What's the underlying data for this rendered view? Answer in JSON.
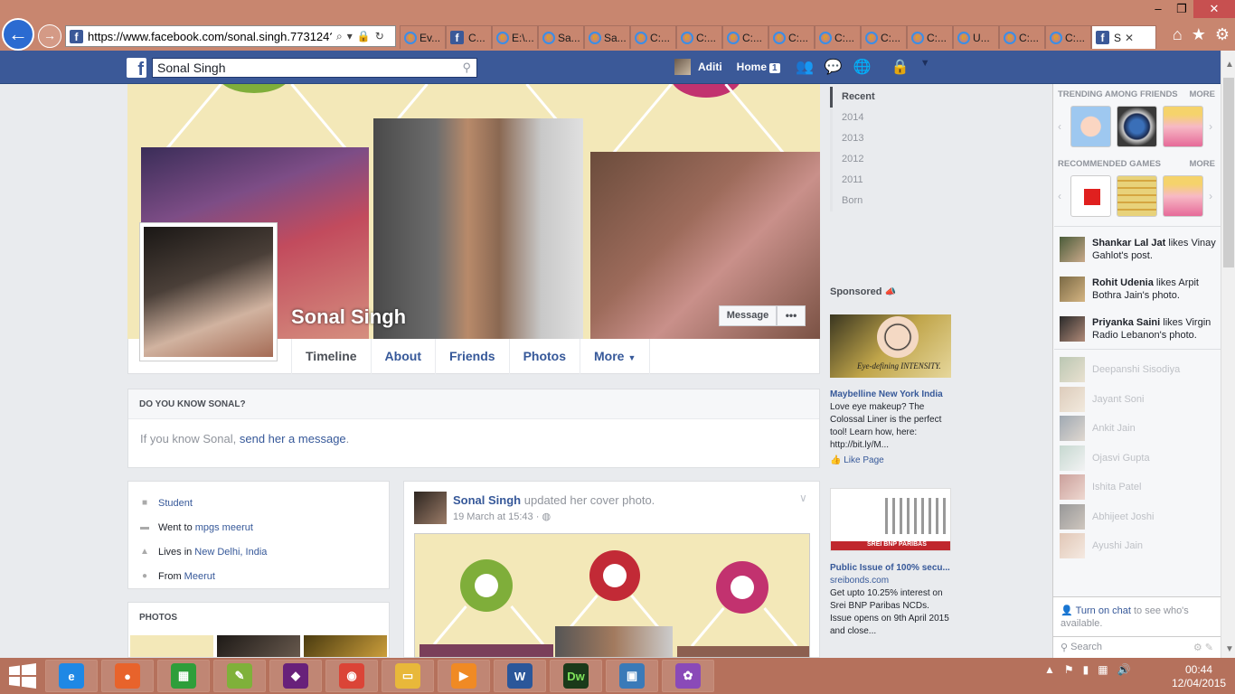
{
  "browser": {
    "url": "https://www.facebook.com/sonal.singh.773124?fre",
    "tabs": [
      "Ev...",
      "C...",
      "E:\\...",
      "Sa...",
      "Sa...",
      "C:...",
      "C:...",
      "C:...",
      "C:...",
      "C:...",
      "C:...",
      "C:...",
      "U...",
      "C:...",
      "C:..."
    ],
    "active_tab": "S",
    "win_min": "‒",
    "win_max": "❐",
    "win_close": "✕"
  },
  "fb_header": {
    "logo": "f",
    "search_value": "Sonal Singh",
    "user_name": "Aditi",
    "home_label": "Home",
    "home_count": "1"
  },
  "profile": {
    "name": "Sonal Singh",
    "message_label": "Message",
    "more_dots": "•••",
    "tabs": [
      "Timeline",
      "About",
      "Friends",
      "Photos",
      "More"
    ]
  },
  "know_box": {
    "title": "DO YOU KNOW SONAL?",
    "text": "If you know Sonal,",
    "link": "send her a message",
    "end": "."
  },
  "intro": {
    "student": "Student",
    "went_prefix": "Went to",
    "went_link": "mpgs meerut",
    "lives_prefix": "Lives in",
    "lives_link": "New Delhi, India",
    "from_prefix": "From",
    "from_link": "Meerut"
  },
  "photos_title": "PHOTOS",
  "post": {
    "author": "Sonal Singh",
    "action": "updated her cover photo.",
    "meta": "19 March at 15:43 · "
  },
  "years": [
    "Recent",
    "2014",
    "2013",
    "2012",
    "2011",
    "Born"
  ],
  "sponsored": {
    "title": "Sponsored",
    "ad1": {
      "image_text": "Eye-defining INTENSITY.",
      "title": "Maybelline New York India",
      "body": "Love eye makeup? The Colossal Liner is the perfect tool! Learn how, here: http://bit.ly/M...",
      "like": "Like Page"
    },
    "ad2": {
      "image_text": "SREI BNP PARIBAS",
      "title": "Public Issue of 100% secu...",
      "domain": "sreibonds.com",
      "body": "Get upto 10.25% interest on Srei BNP Paribas NCDs. Issue opens on 9th April 2015 and close..."
    }
  },
  "right_sidebar": {
    "trending_title": "TRENDING AMONG FRIENDS",
    "recommended_title": "RECOMMENDED GAMES",
    "more": "MORE",
    "ticker": [
      {
        "name": "Shankar Lal Jat",
        "text": "likes Vinay Gahlot's post."
      },
      {
        "name": "Rohit Udenia",
        "text": "likes Arpit Bothra Jain's photo."
      },
      {
        "name": "Priyanka Saini",
        "text": "likes Virgin Radio Lebanon's photo."
      }
    ],
    "chat_friends": [
      "Deepanshi Sisodiya",
      "Jayant Soni",
      "Ankit Jain",
      "Ojasvi Gupta",
      "Ishita Patel",
      "Abhijeet Joshi",
      "Ayushi Jain"
    ],
    "chat_link": "Turn on chat",
    "chat_text": "to see who's available.",
    "chat_search": "Search"
  },
  "taskbar": {
    "apps": [
      "ie-icon",
      "firefox-icon",
      "store-icon",
      "notepadpp-icon",
      "visualstudio-icon",
      "chrome-icon",
      "explorer-icon",
      "media-icon",
      "word-icon",
      "dreamweaver-icon",
      "photos-icon",
      "picasa-icon"
    ],
    "dw_label": "Dw",
    "word_label": "W",
    "time": "00:44",
    "date": "12/04/2015"
  },
  "colors": {
    "chrome": "#c8866f",
    "fb_blue": "#3b5998",
    "link": "#365899",
    "taskbar": "#b5715c"
  }
}
